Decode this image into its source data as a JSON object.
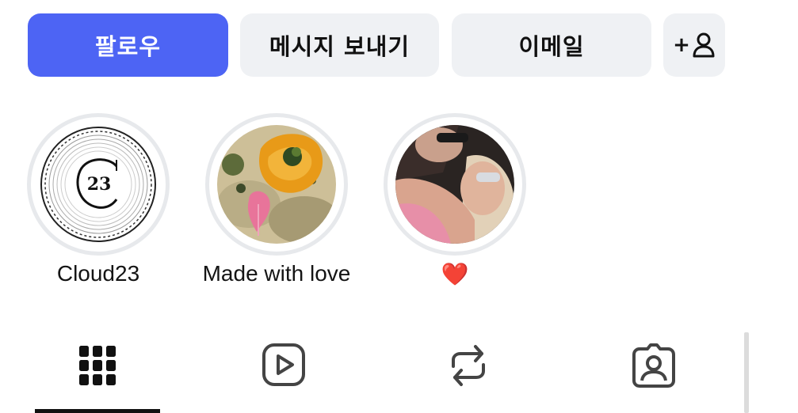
{
  "actions": {
    "follow_label": "팔로우",
    "message_label": "메시지 보내기",
    "email_label": "이메일",
    "add_person_label": "+"
  },
  "highlights": [
    {
      "label": "Cloud23",
      "cover_text": "23"
    },
    {
      "label": "Made with love"
    },
    {
      "label": "❤️"
    }
  ],
  "tabs": [
    {
      "icon": "grid-icon",
      "selected": true
    },
    {
      "icon": "reels-play-icon",
      "selected": false
    },
    {
      "icon": "repost-icon",
      "selected": false
    },
    {
      "icon": "tagged-person-icon",
      "selected": false
    }
  ],
  "colors": {
    "primary": "#4d64f4",
    "button_bg": "#eff1f4",
    "ring": "#e7e9ec",
    "text": "#141414",
    "icon": "#444444"
  }
}
